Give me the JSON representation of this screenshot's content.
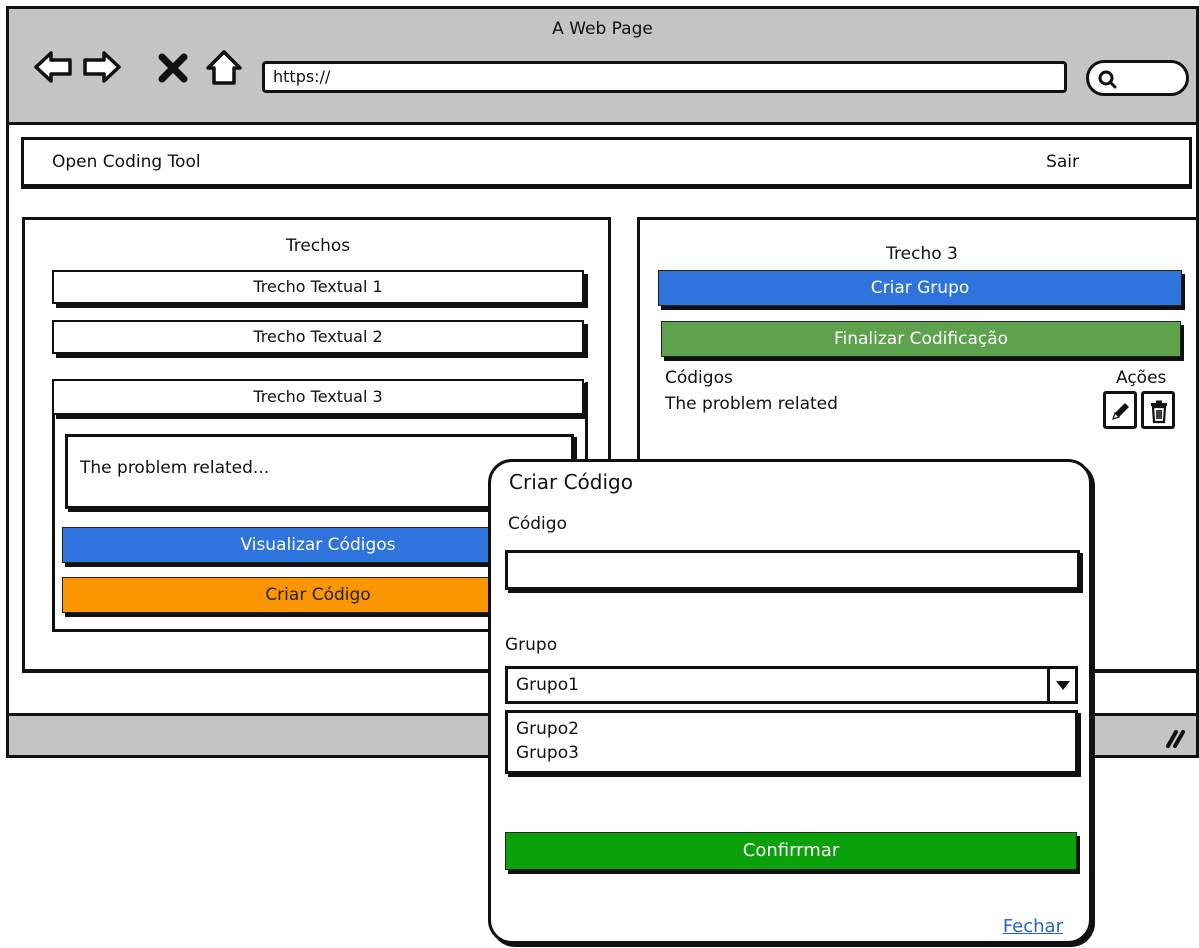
{
  "browser": {
    "window_title": "A Web Page",
    "url": "https://"
  },
  "header": {
    "app_title": "Open Coding Tool",
    "logout_label": "Sair"
  },
  "left_panel": {
    "title": "Trechos",
    "items": [
      {
        "label": "Trecho Textual 1"
      },
      {
        "label": "Trecho Textual 2"
      },
      {
        "label": "Trecho Textual 3"
      }
    ],
    "expanded_text": "The problem related...",
    "view_codes_label": "Visualizar Códigos",
    "create_code_label": "Criar Código"
  },
  "right_panel": {
    "title": "Trecho 3",
    "create_group_label": "Criar Grupo",
    "finalize_label": "Finalizar Codificação",
    "codes_header": "Códigos",
    "actions_header": "Ações",
    "codes": [
      {
        "label": "The problem related"
      }
    ]
  },
  "modal": {
    "title": "Criar Código",
    "code_label": "Código",
    "code_value": "",
    "group_label": "Grupo",
    "group_selected": "Grupo1",
    "group_options": [
      "Grupo2",
      "Grupo3"
    ],
    "confirm_label": "Confirrmar",
    "close_label": "Fechar"
  },
  "colors": {
    "chrome_gray": "#c4c4c4",
    "blue": "#2f73dc",
    "orange": "#fb9500",
    "finalize_green": "#5ea24e",
    "confirm_green": "#0aa10a",
    "link_blue": "#2464c8"
  }
}
